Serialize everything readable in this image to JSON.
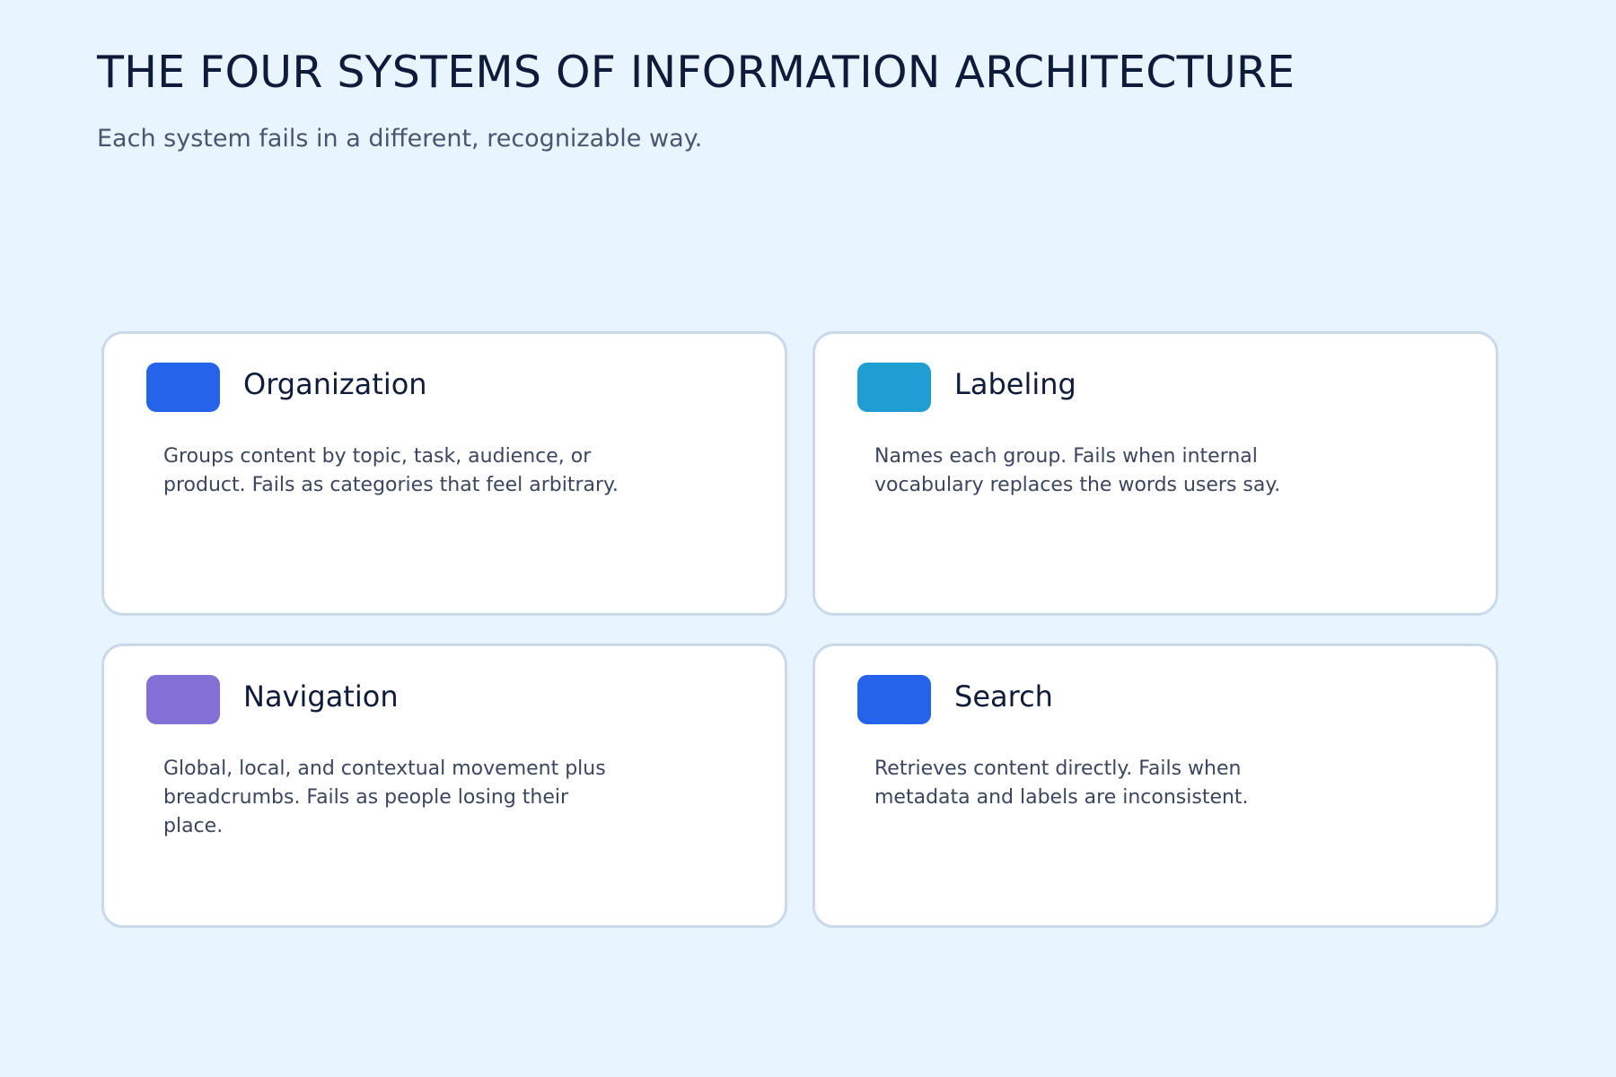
{
  "header": {
    "title": "THE FOUR SYSTEMS OF INFORMATION ARCHITECTURE",
    "subtitle": "Each system fails in a different, recognizable way."
  },
  "cards": [
    {
      "title": "Organization",
      "description": "Groups content by topic, task, audience, or product. Fails as categories that feel arbitrary.",
      "color": "#2563eb"
    },
    {
      "title": "Labeling",
      "description": "Names each group. Fails when internal vocabulary replaces the words users say.",
      "color": "#1f9ed3"
    },
    {
      "title": "Navigation",
      "description": "Global, local, and contextual movement plus breadcrumbs. Fails as people losing their place.",
      "color": "#8270d6"
    },
    {
      "title": "Search",
      "description": "Retrieves content directly. Fails when metadata and labels are inconsistent.",
      "color": "#2563eb"
    }
  ]
}
